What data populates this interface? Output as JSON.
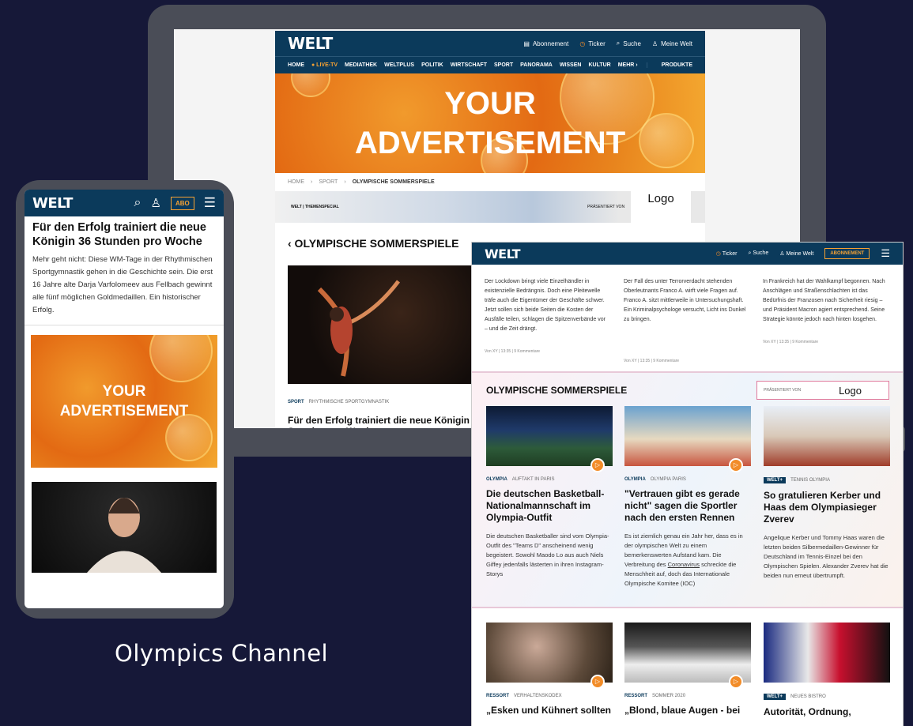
{
  "brand": {
    "logo": "WELT",
    "accent": "#0b3a5b",
    "orange": "#f28c28"
  },
  "desktop": {
    "header": {
      "abonnement": "Abonnement",
      "ticker": "Ticker",
      "suche": "Suche",
      "meine_welt": "Meine Welt"
    },
    "nav": [
      "HOME",
      "● LIVE-TV",
      "MEDIATHEK",
      "WELTPLUS",
      "POLITIK",
      "WIRTSCHAFT",
      "SPORT",
      "PANORAMA",
      "WISSEN",
      "KULTUR",
      "MEHR ›"
    ],
    "nav_products": "PRODUKTE",
    "ad_line1": "YOUR",
    "ad_line2": "ADVERTISEMENT",
    "breadcrumb": [
      "HOME",
      "SPORT",
      "OLYMPISCHE SOMMERSPIELE"
    ],
    "banner_tag": "WELT | THEMENSPECIAL",
    "banner_presented": "PRÄSENTIERT VON",
    "banner_logo": "Logo",
    "section_title": "‹ OLYMPISCHE SOMMERSPIELE",
    "meta_cat": "SPORT",
    "meta_sub": "RHYTHMISCHE SPORTGYMNASTIK",
    "article_title": "Für den Erfolg trainiert die neue Königin 36 Stunden pro Woche"
  },
  "mobile": {
    "abo": "ABO",
    "title": "Für den Erfolg trainiert die neue Königin 36 Stunden pro Woche",
    "lead": "Mehr geht nicht: Diese WM-Tage in der Rhythmischen Sportgymnastik gehen in die Geschichte sein. Die erst 16 Jahre alte Darja Varfolomeev aus Fellbach gewinnt alle fünf möglichen Goldmedaillen. Ein historischer Erfolg.",
    "ad_line1": "YOUR",
    "ad_line2": "ADVERTISEMENT"
  },
  "tablet": {
    "header": {
      "ticker": "Ticker",
      "suche": "Suche",
      "meine_welt": "Meine Welt",
      "abonnement": "ABONNEMENT"
    },
    "top_cols": [
      {
        "text": "Der Lockdown bringt viele Einzelhändler in existenzielle Bedrängnis. Doch eine Pleitewelle träfe auch die Eigentümer der Geschäfte schwer. Jetzt sollen sich beide Seiten die Kosten der Ausfälle teilen, schlagen die Spitzenverbände vor – und die Zeit drängt.",
        "by": "Von XY  |  13:35  |  9 Kommentare"
      },
      {
        "text": "Der Fall des unter Terrorverdacht stehenden Oberleutnants Franco A. wirft viele Fragen auf. Franco A. sitzt mittlerweile in Untersuchungshaft. Ein Kriminalpsychologe versucht, Licht ins Dunkel zu bringen.",
        "by": "Von XY  |  13:35  |  9 Kommentare"
      },
      {
        "text": "In Frankreich hat der Wahlkampf begonnen. Nach Anschlägen und Straßenschlachten ist das Bedürfnis der Franzosen nach Sicherheit riesig – und Präsident Macron agiert entsprechend. Seine Strategie könnte jedoch nach hinten losgehen.",
        "by": "Von XY  |  13:35  |  9 Kommentare"
      }
    ],
    "olympia_title": "OLYMPISCHE SOMMERSPIELE",
    "olympia_presented": "PRÄSENTIERT VON",
    "olympia_logo": "Logo",
    "cards": [
      {
        "cat": "OLYMPIA",
        "sub": "AUFTAKT IN PARIS",
        "title": "Die deutschen Basketball-Nationalmannschaft im Olympia-Outfit",
        "text": "Die deutschen Basketballer sind vom Olympia-Outfit des \"Teams D\" anscheinend wenig begeistert. Sowohl Maodo Lo aus auch Niels Giffey jedenfalls lästerten in ihren Instagram-Storys"
      },
      {
        "cat": "OLYMPIA",
        "sub": "OLYMPIA PARIS",
        "title": "\"Vertrauen gibt es gerade nicht\" sagen die Sportler nach den ersten Rennen",
        "text_before": "Es ist ziemlich genau ein Jahr her, dass es in der olympischen Welt zu einem bemerkenswerten Aufstand kam. Die Verbreitung des ",
        "text_link": "Coronavirus",
        "text_after": " schreckte die Menschheit auf, doch das Internationale Olympische Komitee (IOC)"
      },
      {
        "cat": "WELT+",
        "sub": "TENNIS OLYMPIA",
        "title": "So gratulieren Kerber und Haas dem Olympiasieger Zverev",
        "text": "Angelique Kerber und Tommy Haas waren die letzten beiden Silbermedaillen-Gewinner für Deutschland im Tennis-Einzel bei den Olympischen Spielen. Alexander Zverev hat die beiden nun erneut übertrumpft."
      }
    ],
    "bottom_cards": [
      {
        "cat": "RESSORT",
        "sub": "VERHALTENSKODEX",
        "title": "„Esken und Kühnert sollten"
      },
      {
        "cat": "RESSORT",
        "sub": "SOMMER 2020",
        "title": "„Blond, blaue Augen - bei"
      },
      {
        "cat": "WELT+",
        "sub": "NEUES BISTRO",
        "title": "Autorität, Ordnung,"
      }
    ]
  },
  "caption": "Olympics Channel"
}
